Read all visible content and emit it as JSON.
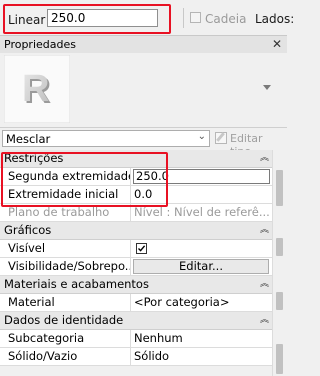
{
  "options_bar": {
    "linear_label": "Linear",
    "linear_value": "250.0",
    "cadeia_label": "Cadeia",
    "lados_label": "Lados:"
  },
  "palette": {
    "title": "Propriedades",
    "type_selector": {
      "value": "Mesclar"
    },
    "edit_type_label": "Editar tipo"
  },
  "groups": [
    {
      "label": "Restrições",
      "rows": [
        {
          "name": "Segunda extremidade",
          "value": "250.0"
        },
        {
          "name": "Extremidade inicial",
          "value": "0.0"
        },
        {
          "name": "Plano de trabalho",
          "value": "Nível : Nível de referê..."
        }
      ]
    },
    {
      "label": "Gráficos",
      "rows": [
        {
          "name": "Visível",
          "checked": true
        },
        {
          "name": "Visibilidade/Sobrepo...",
          "button": "Editar..."
        }
      ]
    },
    {
      "label": "Materiais e acabamentos",
      "rows": [
        {
          "name": "Material",
          "value": "<Por categoria>"
        }
      ]
    },
    {
      "label": "Dados de identidade",
      "rows": [
        {
          "name": "Subcategoria",
          "value": "Nenhum"
        },
        {
          "name": "Sólido/Vazio",
          "value": "Sólido"
        }
      ]
    }
  ]
}
